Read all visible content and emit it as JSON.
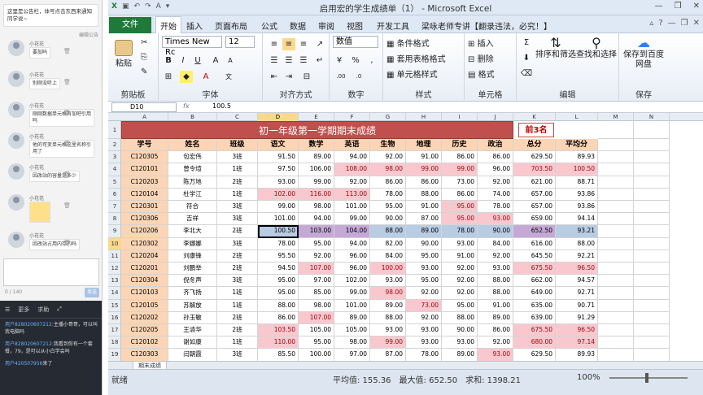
{
  "chat": {
    "notice": "这里是公告栏，体号点击东西来通知同学说~",
    "edit_link": "编辑公告",
    "messages": [
      {
        "name": "小花花",
        "text": "要加吗"
      },
      {
        "name": "小花花",
        "text": "别刚没听上"
      },
      {
        "name": "小花花",
        "text": "刚刚数据单元格有加吧引用吗"
      },
      {
        "name": "小花花",
        "text": "他的可变单元格这里名称引用了"
      },
      {
        "name": "小花花",
        "text": "因改站的容量是多少"
      },
      {
        "name": "小花花",
        "text": "[表情]"
      },
      {
        "name": "小花花",
        "text": "因改站占用内存的吗"
      }
    ],
    "counter": "0 / 140",
    "send": "发送",
    "more": "更多",
    "help": "求助",
    "live": [
      {
        "user": "用户828020607212:",
        "text": "主播小哥哥，可以叫我电脑吗"
      },
      {
        "user": "用户828020607212:",
        "text": "我看到你有一个套餐，79，是可以从小白学会吗"
      },
      {
        "user": "用户420507956",
        "text": "来了"
      }
    ]
  },
  "excel": {
    "title": "启用宏的学生成绩单（1） - Microsoft Excel",
    "tabs": [
      "文件",
      "开始",
      "插入",
      "页面布局",
      "公式",
      "数据",
      "审阅",
      "视图",
      "开发工具",
      "梁咏老师专讲【翻录违法，必究！】"
    ],
    "groups": [
      "剪贴板",
      "字体",
      "对齐方式",
      "数字",
      "样式",
      "单元格",
      "编辑",
      "保存"
    ],
    "ribbon": {
      "paste": "粘贴",
      "font_name": "Times New Rc",
      "font_size": "12",
      "number_format": "数值",
      "cond_format": "条件格式",
      "table_format": "套用表格格式",
      "cell_style": "单元格样式",
      "insert": "插入",
      "delete": "删除",
      "format": "格式",
      "sort": "排序和筛选",
      "find": "查找和选择",
      "save_baidu": "保存到百度网盘"
    },
    "name_box": "D10",
    "fx": "fx",
    "formula": "100.5",
    "columns": [
      "A",
      "B",
      "C",
      "D",
      "E",
      "F",
      "G",
      "H",
      "I",
      "J",
      "K",
      "L",
      "M",
      "N"
    ],
    "sheet_title": "初一年级第一学期期末成绩",
    "badge": "前3名",
    "headers": [
      "学号",
      "姓名",
      "班级",
      "语文",
      "数学",
      "英语",
      "生物",
      "地理",
      "历史",
      "政治",
      "总分",
      "平均分"
    ],
    "rows": [
      [
        "C120305",
        "包宏伟",
        "3班",
        "91.50",
        "89.00",
        "94.00",
        "92.00",
        "91.00",
        "86.00",
        "86.00",
        "629.50",
        "89.93"
      ],
      [
        "C120101",
        "曾令煊",
        "1班",
        "97.50",
        "106.00",
        "108.00",
        "98.00",
        "99.00",
        "99.00",
        "96.00",
        "703.50",
        "100.50"
      ],
      [
        "C120203",
        "陈万地",
        "2班",
        "93.00",
        "99.00",
        "92.00",
        "86.00",
        "86.00",
        "73.00",
        "92.00",
        "621.00",
        "88.71"
      ],
      [
        "C120104",
        "杜学江",
        "1班",
        "102.00",
        "116.00",
        "113.00",
        "78.00",
        "88.00",
        "86.00",
        "74.00",
        "657.00",
        "93.86"
      ],
      [
        "C120301",
        "符合",
        "3班",
        "99.00",
        "98.00",
        "101.00",
        "95.00",
        "91.00",
        "95.00",
        "78.00",
        "657.00",
        "93.86"
      ],
      [
        "C120306",
        "吉祥",
        "3班",
        "101.00",
        "94.00",
        "99.00",
        "90.00",
        "87.00",
        "95.00",
        "93.00",
        "659.00",
        "94.14"
      ],
      [
        "C120206",
        "李北大",
        "2班",
        "100.50",
        "103.00",
        "104.00",
        "88.00",
        "89.00",
        "78.00",
        "90.00",
        "652.50",
        "93.21"
      ],
      [
        "C120302",
        "李娜娜",
        "3班",
        "78.00",
        "95.00",
        "94.00",
        "82.00",
        "90.00",
        "93.00",
        "84.00",
        "616.00",
        "88.00"
      ],
      [
        "C120204",
        "刘康锋",
        "2班",
        "95.50",
        "92.00",
        "96.00",
        "84.00",
        "95.00",
        "91.00",
        "92.00",
        "645.50",
        "92.21"
      ],
      [
        "C120201",
        "刘鹏举",
        "2班",
        "94.50",
        "107.00",
        "96.00",
        "100.00",
        "93.00",
        "92.00",
        "93.00",
        "675.50",
        "96.50"
      ],
      [
        "C120304",
        "倪冬声",
        "3班",
        "95.00",
        "97.00",
        "102.00",
        "93.00",
        "95.00",
        "92.00",
        "88.00",
        "662.00",
        "94.57"
      ],
      [
        "C120103",
        "齐飞扬",
        "1班",
        "95.00",
        "85.00",
        "99.00",
        "98.00",
        "92.00",
        "92.00",
        "88.00",
        "649.00",
        "92.71"
      ],
      [
        "C120105",
        "苏解放",
        "1班",
        "88.00",
        "98.00",
        "101.00",
        "89.00",
        "73.00",
        "95.00",
        "91.00",
        "635.00",
        "90.71"
      ],
      [
        "C120202",
        "孙玉敏",
        "2班",
        "86.00",
        "107.00",
        "89.00",
        "88.00",
        "92.00",
        "88.00",
        "89.00",
        "639.00",
        "91.29"
      ],
      [
        "C120205",
        "王清华",
        "2班",
        "103.50",
        "105.00",
        "105.00",
        "93.00",
        "93.00",
        "90.00",
        "86.00",
        "675.50",
        "96.50"
      ],
      [
        "C120102",
        "谢如康",
        "1班",
        "110.00",
        "95.00",
        "98.00",
        "99.00",
        "93.00",
        "93.00",
        "92.00",
        "680.00",
        "97.14"
      ],
      [
        "C120303",
        "闫朝霞",
        "3班",
        "85.50",
        "100.00",
        "97.00",
        "87.00",
        "78.00",
        "89.00",
        "93.00",
        "629.50",
        "89.93"
      ]
    ],
    "highlights": [
      [
        1,
        5
      ],
      [
        1,
        6
      ],
      [
        1,
        7
      ],
      [
        1,
        8
      ],
      [
        1,
        10
      ],
      [
        1,
        11
      ],
      [
        3,
        3
      ],
      [
        3,
        4
      ],
      [
        3,
        5
      ],
      [
        4,
        8
      ],
      [
        5,
        8
      ],
      [
        5,
        9
      ],
      [
        9,
        4
      ],
      [
        9,
        6
      ],
      [
        9,
        10
      ],
      [
        9,
        11
      ],
      [
        11,
        6
      ],
      [
        12,
        7
      ],
      [
        13,
        4
      ],
      [
        14,
        3
      ],
      [
        14,
        10
      ],
      [
        14,
        11
      ],
      [
        15,
        3
      ],
      [
        15,
        6
      ],
      [
        15,
        10
      ],
      [
        15,
        11
      ],
      [
        16,
        9
      ]
    ],
    "sheet_tab": "期末成绩",
    "status": {
      "ready": "就绪",
      "average": "平均值: 155.36",
      "count": "最大值: 652.50",
      "sum": "求和: 1398.21",
      "zoom": "100%"
    },
    "colors": {
      "accent": "#1f7a3a",
      "title_red": "#c0504d",
      "header_orange": "#fbd5b5",
      "highlight_pink": "#f9c8cf",
      "selected_blue": "#b8cce4"
    }
  }
}
